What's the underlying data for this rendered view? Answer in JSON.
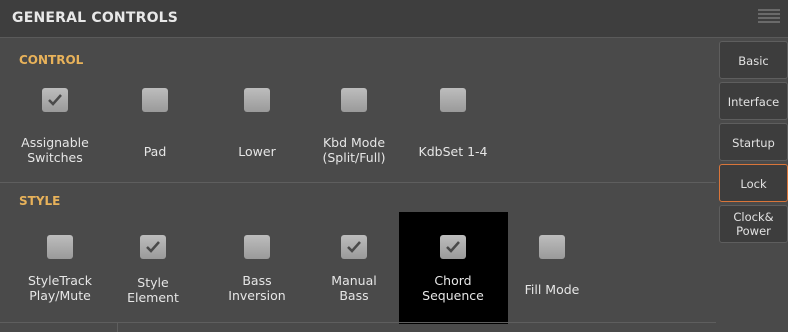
{
  "header": {
    "title": "GENERAL CONTROLS",
    "menu_icon": "hamburger-icon"
  },
  "control": {
    "title": "CONTROL",
    "items": [
      {
        "label": "Assignable Switches",
        "line1": "Assignable",
        "line2": "Switches",
        "checked": true
      },
      {
        "label": "Pad",
        "line1": "Pad",
        "line2": "",
        "checked": false
      },
      {
        "label": "Lower",
        "line1": "Lower",
        "line2": "",
        "checked": false
      },
      {
        "label": "Kbd Mode (Split/Full)",
        "line1": "Kbd Mode",
        "line2": "(Split/Full)",
        "checked": false
      },
      {
        "label": "KdbSet 1-4",
        "line1": "KdbSet 1-4",
        "line2": "",
        "checked": false
      }
    ]
  },
  "style": {
    "title": "STYLE",
    "items": [
      {
        "label": "StyleTrack Play/Mute",
        "line1": "StyleTrack",
        "line2": "Play/Mute",
        "checked": false
      },
      {
        "label": "Style Element",
        "line1": "Style",
        "line2": "Element",
        "checked": true
      },
      {
        "label": "Bass Inversion",
        "line1": "Bass",
        "line2": "Inversion",
        "checked": false
      },
      {
        "label": "Manual Bass",
        "line1": "Manual",
        "line2": "Bass",
        "checked": true
      },
      {
        "label": "Chord Sequence",
        "line1": "Chord",
        "line2": "Sequence",
        "checked": true
      },
      {
        "label": "Fill Mode",
        "line1": "Fill Mode",
        "line2": "",
        "checked": false
      }
    ]
  },
  "tabs": [
    {
      "line1": "Basic",
      "line2": ""
    },
    {
      "line1": "Interface",
      "line2": ""
    },
    {
      "line1": "Startup",
      "line2": ""
    },
    {
      "line1": "Lock",
      "line2": ""
    },
    {
      "line1": "Clock&",
      "line2": "Power"
    }
  ],
  "colors": {
    "section_title": "#e8b25a",
    "active_tab_border": "#d9753a",
    "background": "#4a4a4a"
  }
}
